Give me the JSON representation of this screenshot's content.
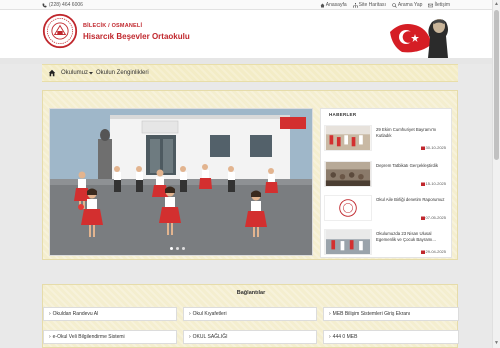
{
  "topbar": {
    "phone": "(228) 464 6006",
    "links": [
      {
        "label": "Anasayfa",
        "icon": "home-icon"
      },
      {
        "label": "Site Haritası",
        "icon": "sitemap-icon"
      },
      {
        "label": "Arama Yap",
        "icon": "search-icon"
      },
      {
        "label": "İletişim",
        "icon": "mail-icon"
      }
    ]
  },
  "header": {
    "subtitle": "BİLECİK / OSMANELİ",
    "school_name": "Hisarcık Beşevler Ortaokulu"
  },
  "nav": {
    "menu_label": "Okulumuz",
    "secondary_label": "Okulun Zenginlikleri"
  },
  "news": {
    "title": "HABERLER",
    "items": [
      {
        "text": "29 Ekim Cumhuriyet Bayramı'nı Kutladık",
        "date": "30-10-2025"
      },
      {
        "text": "Deprem Tatbikatı Gerçekleştirdik",
        "date": "15-10-2025"
      },
      {
        "text": "Okul Aile Birliği denetim Raporumuz",
        "date": "07-05-2025"
      },
      {
        "text": "Okulumuzda 23 Nisan Ulusal Egemenlik ve Çocuk Bayramı...",
        "date": "29-04-2025"
      }
    ]
  },
  "links": {
    "title": "Bağlantılar",
    "items": [
      "Okuldan Randevu Al",
      "Okul Kıyafetleri",
      "MEB Bilişim Sistemleri Giriş Ekranı",
      "e-Okul Veli Bilgilendirme Sistemi",
      "OKUL SAĞLIĞI",
      "444 0 MEB"
    ]
  },
  "colors": {
    "brand_red": "#c0272d",
    "panel_bg": "#f4eecf"
  }
}
